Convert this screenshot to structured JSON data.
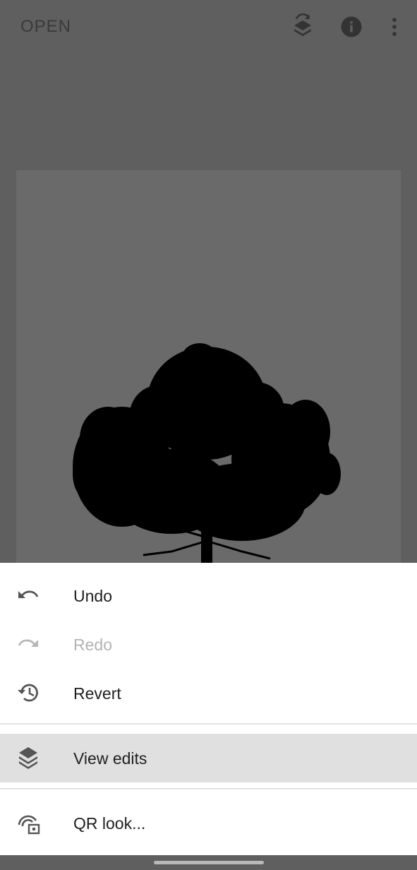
{
  "topbar": {
    "open_label": "OPEN",
    "icons": [
      "layers-swap-icon",
      "info-icon",
      "more-vert-icon"
    ]
  },
  "photo": {
    "subject": "tree-silhouette"
  },
  "menu": {
    "items": [
      {
        "label": "Undo",
        "icon": "undo-icon",
        "enabled": true
      },
      {
        "label": "Redo",
        "icon": "redo-icon",
        "enabled": false
      },
      {
        "label": "Revert",
        "icon": "history-icon",
        "enabled": true
      },
      {
        "label": "View edits",
        "icon": "layers-icon",
        "enabled": true,
        "highlighted": true
      },
      {
        "label": "QR look...",
        "icon": "qr-look-icon",
        "enabled": true
      }
    ]
  },
  "colors": {
    "scrim": "#5f5f5f",
    "sheet": "#ffffff",
    "highlight": "#e0e0e0",
    "disabled_text": "#b3b3b3"
  }
}
